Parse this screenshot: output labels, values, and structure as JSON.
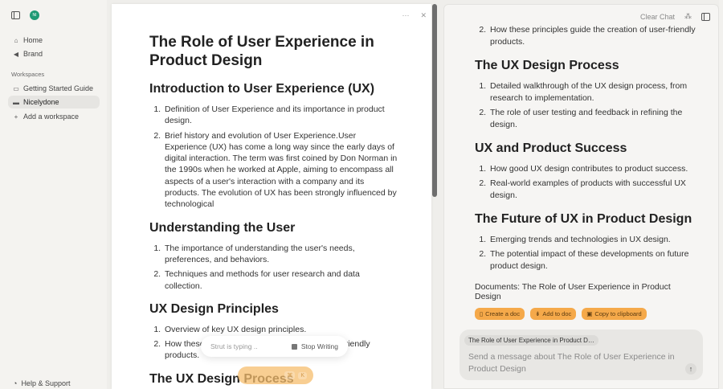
{
  "sidebar": {
    "avatar": "NI",
    "home": "Home",
    "brand": "Brand",
    "workspaces_label": "Workspaces",
    "workspaces": [
      "Getting Started Guide",
      "Nicelydone"
    ],
    "add_workspace": "Add a workspace",
    "help": "Help & Support"
  },
  "doc": {
    "title": "The Role of User Experience in Product Design",
    "sections": [
      {
        "heading": "Introduction to User Experience (UX)",
        "items": [
          "Definition of User Experience and its importance in product design.",
          "Brief history and evolution of User Experience.User Experience (UX) has come a long way since the early days of digital interaction. The term was first coined by Don Norman in the 1990s when he worked at Apple, aiming to encompass all aspects of a user's interaction with a company and its products. The evolution of UX has been strongly influenced by technological"
        ]
      },
      {
        "heading": "Understanding the User",
        "items": [
          "The importance of understanding the user's needs, preferences, and behaviors.",
          "Techniques and methods for user research and data collection."
        ]
      },
      {
        "heading": "UX Design Principles",
        "items": [
          "Overview of key UX design principles.",
          "How these principles guide the creation of user-friendly products."
        ]
      },
      {
        "heading": "The UX Design Process",
        "items": []
      }
    ],
    "typing": "Strut is typing ..",
    "stop": "Stop Writing",
    "kbd1": "⌘",
    "kbd2": "K"
  },
  "chat": {
    "clear": "Clear Chat",
    "first_item": "How these principles guide the creation of user-friendly products.",
    "sections": [
      {
        "heading": "The UX Design Process",
        "items": [
          "Detailed walkthrough of the UX design process, from research to implementation.",
          "The role of user testing and feedback in refining the design."
        ]
      },
      {
        "heading": "UX and Product Success",
        "items": [
          "How good UX design contributes to product success.",
          "Real-world examples of products with successful UX design."
        ]
      },
      {
        "heading": "The Future of UX in Product Design",
        "items": [
          "Emerging trends and technologies in UX design.",
          "The potential impact of these developments on future product design."
        ]
      }
    ],
    "documents": "Documents: The Role of User Experience in Product Design",
    "actions": [
      "Create a doc",
      "Add to doc",
      "Copy to clipboard"
    ],
    "chip": "The Role of User Experience in Product Design",
    "placeholder": "Send a message about The Role of User Experience in Product Design"
  }
}
